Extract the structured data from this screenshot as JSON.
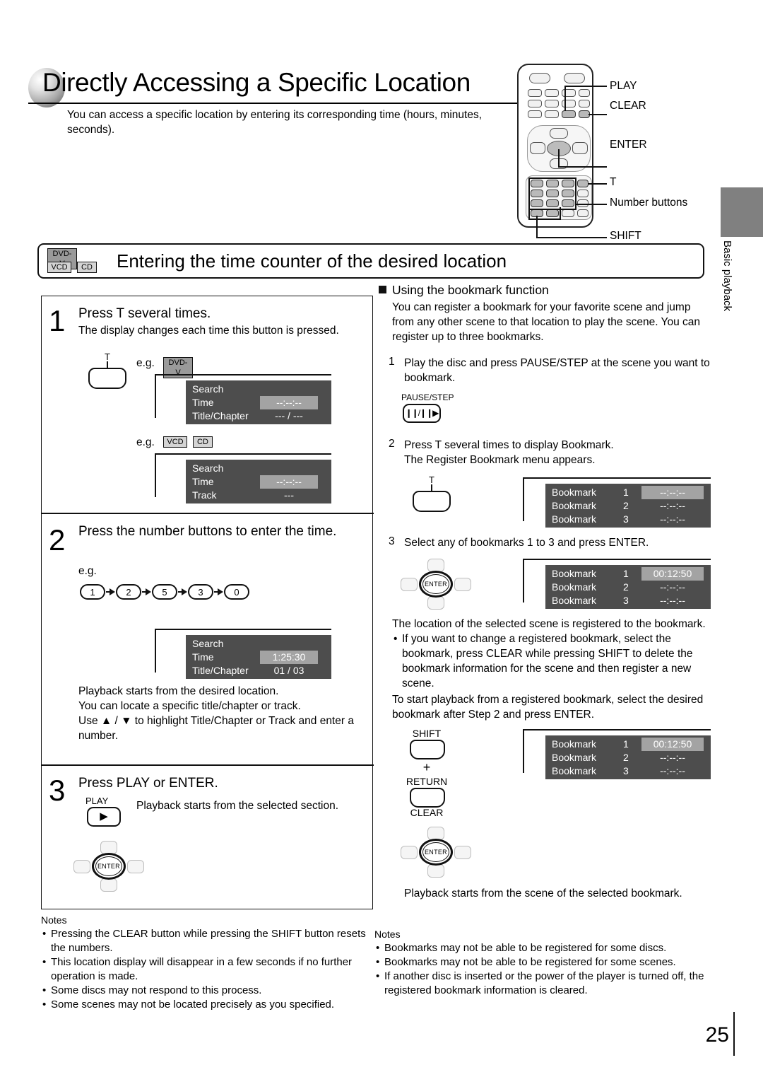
{
  "page": {
    "number": "25",
    "side_tab_label": "Basic playback"
  },
  "header": {
    "title": "Directly Accessing a Specific Location",
    "subtitle": "You can access a specific location by entering its corresponding time (hours, minutes, seconds)."
  },
  "remote": {
    "callouts": [
      "PLAY",
      "CLEAR",
      "ENTER",
      "T",
      "Number buttons",
      "SHIFT"
    ]
  },
  "section": {
    "badges": [
      {
        "label": "DVD-V",
        "style": "dark"
      },
      {
        "label": "VCD",
        "style": "light"
      },
      {
        "label": "CD",
        "style": "light"
      }
    ],
    "title": "Entering the time counter of the desired location"
  },
  "steps": [
    {
      "number": "1",
      "heading": "Press T several times.",
      "body": "The display changes each time this button is pressed.",
      "key_label": "T",
      "eg_label": "e.g.",
      "eg_badge_1": "DVD-V",
      "eg_badge_2": "VCD",
      "eg_badge_3": "CD",
      "osd_dvd": {
        "title": "Search",
        "rows": [
          {
            "label": "Time",
            "value": "--:--:--",
            "highlight": true
          },
          {
            "label": "Title/Chapter",
            "value": "--- / ---",
            "highlight": false
          }
        ]
      },
      "osd_vcd": {
        "title": "Search",
        "rows": [
          {
            "label": "Time",
            "value": "--:--:--",
            "highlight": true
          },
          {
            "label": "Track",
            "value": "---",
            "highlight": false
          }
        ]
      }
    },
    {
      "number": "2",
      "heading": "Press the number buttons to enter the time.",
      "eg_label": "e.g.",
      "keys": [
        "1",
        "2",
        "5",
        "3",
        "0"
      ],
      "osd": {
        "title": "Search",
        "rows": [
          {
            "label": "Time",
            "value": "1:25:30",
            "highlight": true
          },
          {
            "label": "Title/Chapter",
            "value": "01 / 03",
            "highlight": false
          }
        ]
      },
      "body": "Playback starts from the desired location.\nYou can locate a specific title/chapter or track.\nUse ▲ / ▼ to highlight Title/Chapter or Track and enter a number."
    },
    {
      "number": "3",
      "heading": "Press PLAY or ENTER.",
      "key_label": "PLAY",
      "key_glyph": "▶",
      "body": "Playback starts from the selected section.",
      "enter_label": "ENTER"
    }
  ],
  "left_notes": {
    "title": "Notes",
    "items": [
      "Pressing the CLEAR button while pressing the SHIFT button resets the numbers.",
      "This location display will disappear in a few seconds if no further operation is made.",
      "Some discs may not respond to this process.",
      "Some scenes may not be located precisely as you specified."
    ]
  },
  "bookmark": {
    "heading": "Using the bookmark function",
    "intro": "You can register a bookmark for your favorite scene and jump from any other scene to that location to play the scene. You can register up to three bookmarks.",
    "step1": {
      "number": "1",
      "text": "Play the disc and press PAUSE/STEP at the scene you want to bookmark.",
      "key_label": "PAUSE/STEP",
      "key_glyph": "❙❙/❙❙▶"
    },
    "step2": {
      "number": "2",
      "text": "Press T several times to display Bookmark.\nThe Register Bookmark menu appears.",
      "key_label": "T",
      "osd": {
        "rows": [
          {
            "label": "Bookmark",
            "index": "1",
            "value": "--:--:--",
            "highlight": true
          },
          {
            "label": "Bookmark",
            "index": "2",
            "value": "--:--:--",
            "highlight": false
          },
          {
            "label": "Bookmark",
            "index": "3",
            "value": "--:--:--",
            "highlight": false
          }
        ]
      }
    },
    "step3": {
      "number": "3",
      "text": "Select any of bookmarks 1 to 3 and press ENTER.",
      "enter_label": "ENTER",
      "osd": {
        "rows": [
          {
            "label": "Bookmark",
            "index": "1",
            "value": "00:12:50",
            "highlight": true
          },
          {
            "label": "Bookmark",
            "index": "2",
            "value": "--:--:--",
            "highlight": false
          },
          {
            "label": "Bookmark",
            "index": "3",
            "value": "--:--:--",
            "highlight": false
          }
        ]
      }
    },
    "after_register": "The location of the selected scene is registered to the bookmark.",
    "change_note": "If you want to change a registered bookmark, select the bookmark, press CLEAR while pressing SHIFT to delete the bookmark information for the scene and then register a new scene.",
    "restart_text": "To start playback from a registered bookmark, select the desired bookmark after Step 2 and press ENTER.",
    "combo": {
      "shift_label": "SHIFT",
      "plus": "+",
      "return_label": "RETURN",
      "clear_label": "CLEAR",
      "enter_label": "ENTER"
    },
    "osd_final": {
      "rows": [
        {
          "label": "Bookmark",
          "index": "1",
          "value": "00:12:50",
          "highlight": true
        },
        {
          "label": "Bookmark",
          "index": "2",
          "value": "--:--:--",
          "highlight": false
        },
        {
          "label": "Bookmark",
          "index": "3",
          "value": "--:--:--",
          "highlight": false
        }
      ]
    },
    "result": "Playback starts from the scene of the selected bookmark."
  },
  "right_notes": {
    "title": "Notes",
    "items": [
      "Bookmarks may not be able to be registered for some discs.",
      "Bookmarks may not be able to be registered for some scenes.",
      "If another disc is inserted or the power of the player is turned off, the registered bookmark information is cleared."
    ]
  },
  "colors": {
    "osd_bg": "#4d4d4d",
    "osd_highlight": "#a3a3a3",
    "side_tab": "#808080",
    "badge_dark": "#9a9a9a",
    "badge_light": "#d4d4d4"
  }
}
